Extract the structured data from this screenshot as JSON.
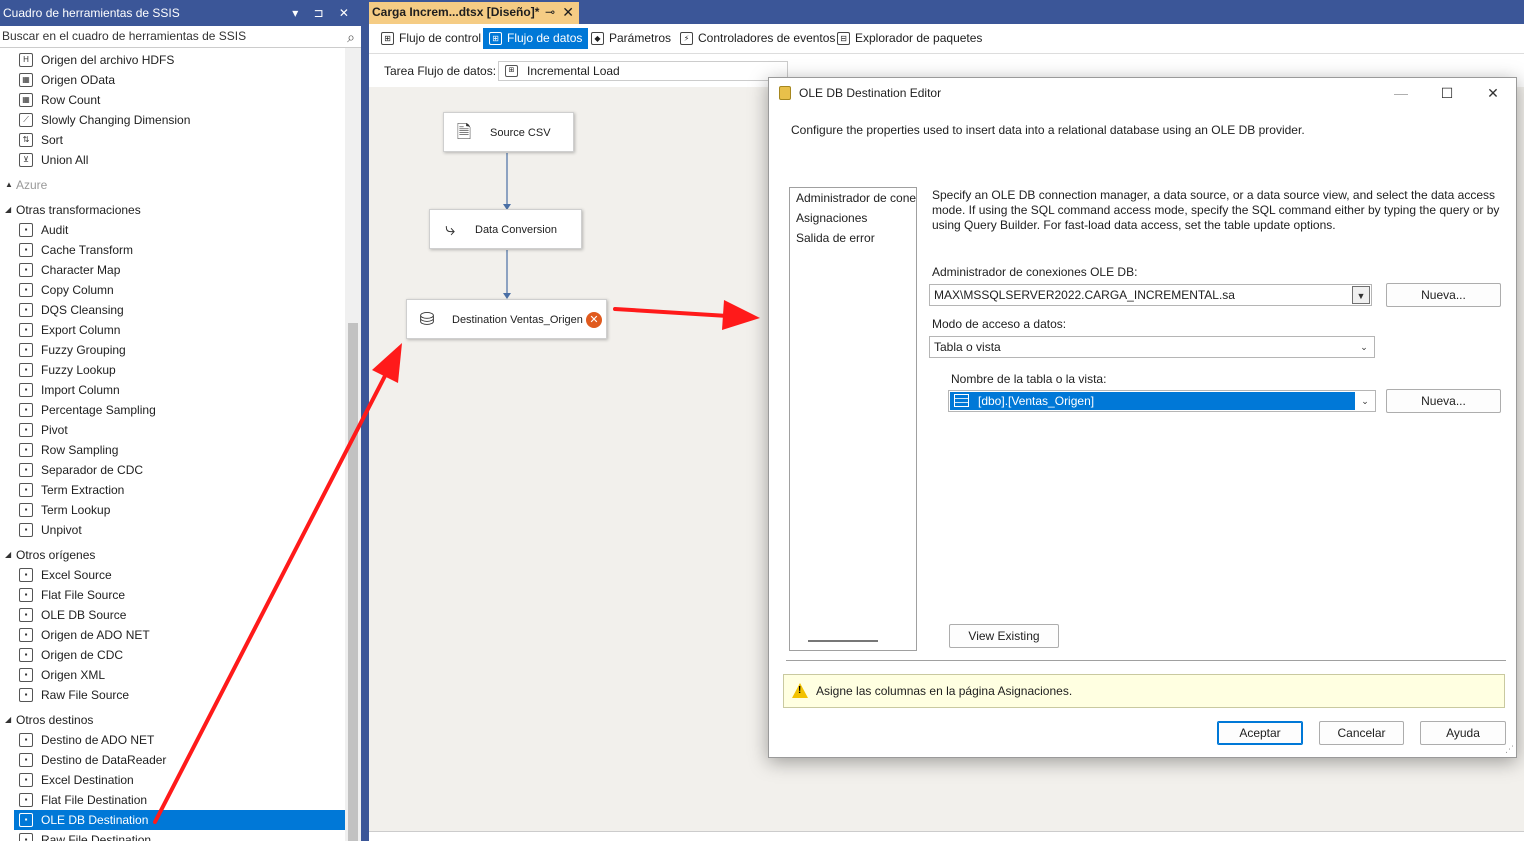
{
  "toolbox": {
    "title": "Cuadro de herramientas de SSIS",
    "title_controls": "▾ ⊐ ✕",
    "search_placeholder": "Buscar en el cuadro de herramientas de SSIS",
    "items_top": [
      "Origen del archivo HDFS",
      "Origen OData",
      "Row Count",
      "Slowly Changing Dimension",
      "Sort",
      "Union All"
    ],
    "cat_azure": "Azure",
    "cat_other_transforms": "Otras transformaciones",
    "items_transforms": [
      "Audit",
      "Cache Transform",
      "Character Map",
      "Copy Column",
      "DQS Cleansing",
      "Export Column",
      "Fuzzy Grouping",
      "Fuzzy Lookup",
      "Import Column",
      "Percentage Sampling",
      "Pivot",
      "Row Sampling",
      "Separador de CDC",
      "Term Extraction",
      "Term Lookup",
      "Unpivot"
    ],
    "cat_other_sources": "Otros orígenes",
    "items_sources": [
      "Excel Source",
      "Flat File Source",
      "OLE DB Source",
      "Origen de ADO NET",
      "Origen de CDC",
      "Origen XML",
      "Raw File Source"
    ],
    "cat_other_destinations": "Otros destinos",
    "items_destinations": [
      "Destino de ADO NET",
      "Destino de DataReader",
      "Excel Destination",
      "Flat File Destination",
      "OLE DB Destination",
      "Raw File Destination"
    ],
    "selected_item": "OLE DB Destination"
  },
  "document": {
    "tab_title": "Carga Increm...dtsx [Diseño]*",
    "tab_pin": "⊸",
    "tab_close": "✕",
    "designer_tabs": [
      "Flujo de control",
      "Flujo de datos",
      "Parámetros",
      "Controladores de eventos",
      "Explorador de paquetes"
    ],
    "active_designer_tab": "Flujo de datos",
    "task_label": "Tarea Flujo de datos:",
    "task_value": "Incremental Load"
  },
  "canvas": {
    "nodes": [
      "Source CSV",
      "Data Conversion",
      "Destination Ventas_Origen"
    ],
    "error_glyph": "✕"
  },
  "dialog": {
    "title": "OLE DB Destination Editor",
    "minimize": "—",
    "maximize": "☐",
    "close": "✕",
    "description": "Configure the properties used to insert data into a relational database using an OLE DB provider.",
    "nav_items": [
      "Administrador de conexiones",
      "Asignaciones",
      "Salida de error"
    ],
    "info_text": "Specify an OLE DB connection manager, a data source, or a data source view, and select the data access mode. If using the SQL command access mode, specify the SQL command either by typing the query or by using Query Builder. For fast-load data access, set the table update options.",
    "conn_label": "Administrador de conexiones OLE DB:",
    "conn_value": "MAX\\MSSQLSERVER2022.CARGA_INCREMENTAL.sa",
    "new_button_1": "Nueva...",
    "access_label": "Modo de acceso a datos:",
    "access_value": "Tabla o vista",
    "table_label": "Nombre de la tabla o la vista:",
    "table_value": "[dbo].[Ventas_Origen]",
    "new_button_2": "Nueva...",
    "view_existing": "View Existing",
    "warning": "Asigne las columnas en la página Asignaciones.",
    "ok": "Aceptar",
    "cancel": "Cancelar",
    "help": "Ayuda"
  },
  "colors": {
    "vs_blue": "#3b5698",
    "tab_gold": "#f5cc84",
    "selection": "#0078d7",
    "arrow_red": "#ff1a1a",
    "canvas_bg": "#f2f0ec"
  },
  "icons": [
    "search-icon",
    "database-icon",
    "warning-icon",
    "error-icon"
  ]
}
